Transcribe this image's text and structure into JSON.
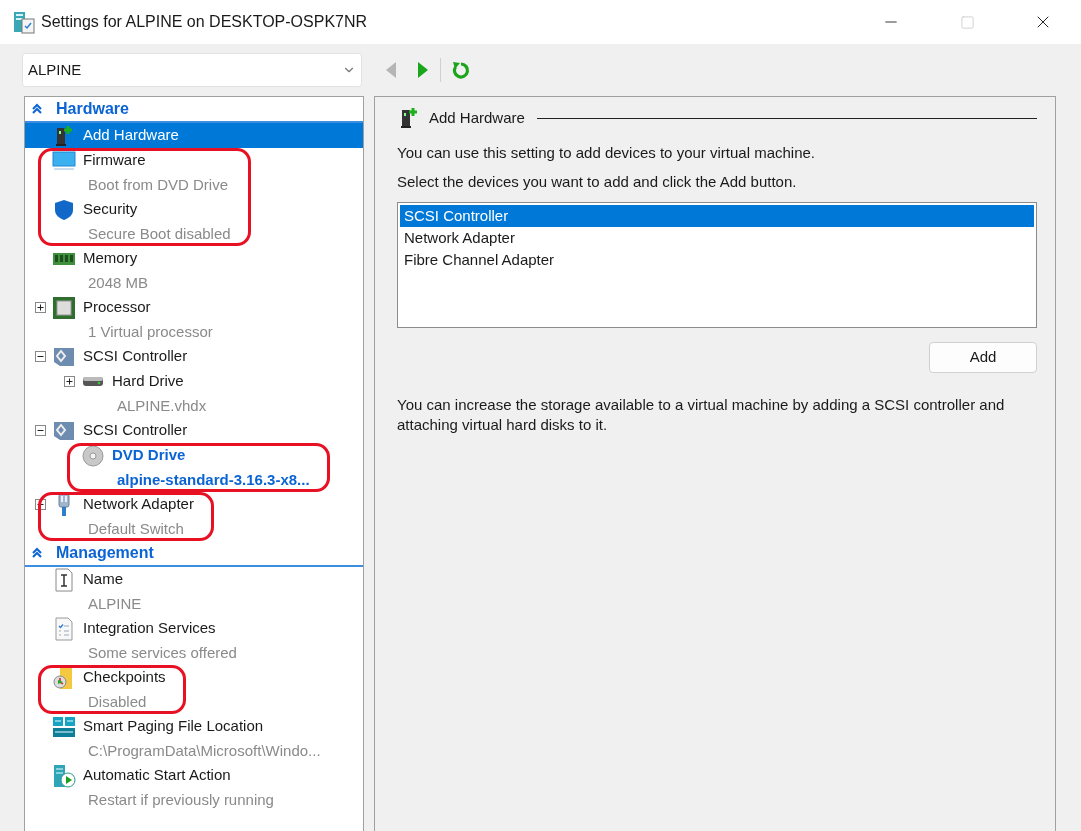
{
  "window": {
    "title": "Settings for ALPINE on DESKTOP-OSPK7NR",
    "controls": [
      {
        "kind": "minimize",
        "disabled": false
      },
      {
        "kind": "maximize",
        "disabled": true
      },
      {
        "kind": "close",
        "disabled": false
      }
    ]
  },
  "vm_select": {
    "value": "ALPINE"
  },
  "toolbar": [
    {
      "kind": "back",
      "disabled": true
    },
    {
      "kind": "forward",
      "disabled": false
    },
    {
      "kind": "refresh",
      "disabled": false
    }
  ],
  "sidebar": {
    "sections": [
      {
        "title": "Hardware",
        "expanded": true,
        "items": [
          {
            "kind": "add-hardware",
            "label": "Add Hardware",
            "selected": true,
            "modified": false,
            "highlighted": false
          },
          {
            "kind": "firmware",
            "label": "Firmware",
            "detail": "Boot from DVD Drive",
            "selected": false,
            "modified": false,
            "highlighted": true
          },
          {
            "kind": "security",
            "label": "Security",
            "detail": "Secure Boot disabled",
            "selected": false,
            "modified": false,
            "highlighted": true
          },
          {
            "kind": "memory",
            "label": "Memory",
            "detail": "2048 MB",
            "selected": false,
            "modified": false,
            "highlighted": false
          },
          {
            "kind": "processor",
            "label": "Processor",
            "detail": "1 Virtual processor",
            "selected": false,
            "modified": false,
            "highlighted": false,
            "expanded": false
          },
          {
            "kind": "scsi",
            "label": "SCSI Controller",
            "selected": false,
            "modified": false,
            "highlighted": false,
            "expanded": true,
            "children": [
              {
                "kind": "disk",
                "label": "Hard Drive",
                "detail": "ALPINE.vhdx",
                "selected": false,
                "modified": false,
                "highlighted": false,
                "expanded": false
              }
            ]
          },
          {
            "kind": "scsi",
            "label": "SCSI Controller",
            "selected": false,
            "modified": false,
            "highlighted": false,
            "expanded": true,
            "children": [
              {
                "kind": "dvd",
                "label": "DVD Drive",
                "detail": "alpine-standard-3.16.3-x8...",
                "selected": false,
                "modified": true,
                "highlighted": true
              }
            ]
          },
          {
            "kind": "network",
            "label": "Network Adapter",
            "detail": "Default Switch",
            "selected": false,
            "modified": false,
            "highlighted": true,
            "expanded": false
          }
        ]
      },
      {
        "title": "Management",
        "expanded": true,
        "items": [
          {
            "kind": "name",
            "label": "Name",
            "detail": "ALPINE",
            "selected": false,
            "modified": false,
            "highlighted": false
          },
          {
            "kind": "integration",
            "label": "Integration Services",
            "detail": "Some services offered",
            "selected": false,
            "modified": false,
            "highlighted": false
          },
          {
            "kind": "checkpoints",
            "label": "Checkpoints",
            "detail": "Disabled",
            "selected": false,
            "modified": false,
            "highlighted": true
          },
          {
            "kind": "paging",
            "label": "Smart Paging File Location",
            "detail": "C:\\ProgramData\\Microsoft\\Windo...",
            "selected": false,
            "modified": false,
            "highlighted": false
          },
          {
            "kind": "autostart",
            "label": "Automatic Start Action",
            "detail": "Restart if previously running",
            "selected": false,
            "modified": false,
            "highlighted": false
          }
        ]
      }
    ]
  },
  "panel": {
    "heading": "Add Hardware",
    "intro": "You can use this setting to add devices to your virtual machine.",
    "instruction": "Select the devices you want to add and click the Add button.",
    "devices": [
      {
        "label": "SCSI Controller",
        "selected": true
      },
      {
        "label": "Network Adapter",
        "selected": false
      },
      {
        "label": "Fibre Channel Adapter",
        "selected": false
      }
    ],
    "add_button": "Add",
    "note": "You can increase the storage available to a virtual machine by adding a SCSI controller and attaching virtual hard disks to it."
  }
}
